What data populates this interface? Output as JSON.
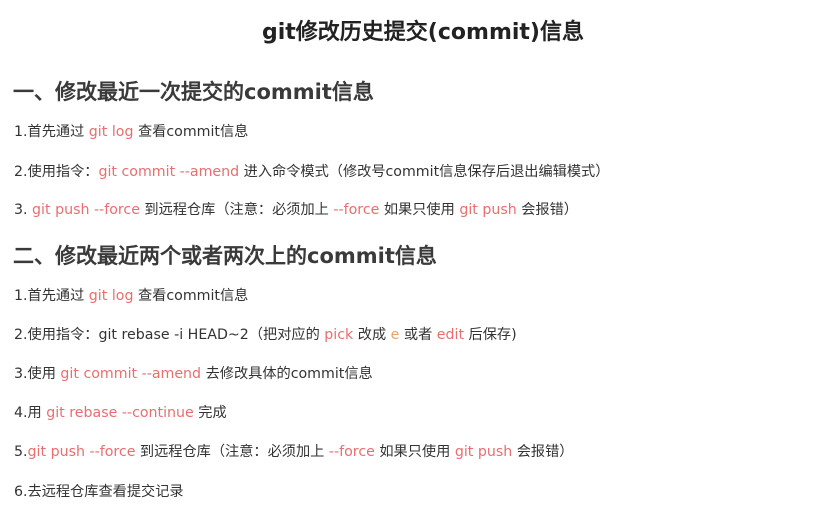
{
  "title": "git修改历史提交(commit)信息",
  "section1": {
    "heading": "一、修改最近一次提交的commit信息",
    "step1": {
      "pre": "1.首先通过 ",
      "code": "git log",
      "post": " 查看commit信息"
    },
    "step2": {
      "pre": "2.使用指令：",
      "code": "git commit --amend",
      "post": " 进入命令模式（修改号commit信息保存后退出编辑模式）"
    },
    "step3": {
      "pre": "3. ",
      "code": "git push --force",
      "mid": " 到远程仓库（注意：必须加上 ",
      "code2": "--force",
      "mid2": " 如果只使用 ",
      "code3": "git push",
      "post": " 会报错）"
    }
  },
  "section2": {
    "heading": "二、修改最近两个或者两次上的commit信息",
    "step1": {
      "pre": "1.首先通过 ",
      "code": "git log",
      "post": " 查看commit信息"
    },
    "step2": {
      "pre": "2.使用指令：git rebase -i HEAD~2（把对应的 ",
      "code": "pick",
      "mid": " 改成 ",
      "code2": "e",
      "mid2": " 或者 ",
      "code3": "edit",
      "post": " 后保存)"
    },
    "step3": {
      "pre": "3.使用 ",
      "code": "git commit --amend",
      "post": " 去修改具体的commit信息"
    },
    "step4": {
      "pre": "4.用 ",
      "code": "git rebase --continue",
      "post": " 完成"
    },
    "step5": {
      "pre": "5.",
      "code": "git push --force",
      "mid": " 到远程仓库（注意：必须加上 ",
      "code2": "--force",
      "mid2": " 如果只使用 ",
      "code3": "git push",
      "post": " 会报错）"
    },
    "step6": {
      "text": "6.去远程仓库查看提交记录"
    }
  }
}
